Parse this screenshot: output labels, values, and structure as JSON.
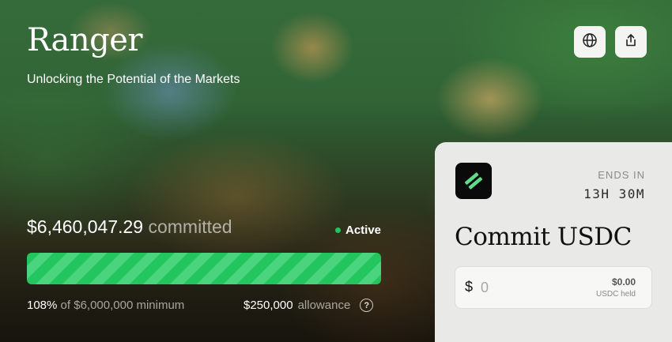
{
  "header": {
    "title": "Ranger",
    "subtitle": "Unlocking the Potential of the Markets",
    "actions": [
      {
        "icon": "globe-icon"
      },
      {
        "icon": "share-icon"
      }
    ]
  },
  "raise": {
    "committed_amount": "$6,460,047.29",
    "committed_label": "committed",
    "status": "Active",
    "status_color": "#22c55e",
    "progress_percent_of_minimum": 108,
    "progress_bar_fill_fraction": 1.0,
    "percent_text": "108%",
    "minimum_text": "of $6,000,000 minimum",
    "allowance_amount": "$250,000",
    "allowance_label": "allowance",
    "help_glyph": "?"
  },
  "commit_panel": {
    "ends_label": "ENDS IN",
    "ends_value": "13H 30M",
    "title": "Commit USDC",
    "currency_symbol": "$",
    "amount_placeholder": "0",
    "held_value": "$0.00",
    "held_label": "USDC held"
  },
  "colors": {
    "accent": "#22c55e",
    "panel_bg": "#e9e9e7"
  }
}
